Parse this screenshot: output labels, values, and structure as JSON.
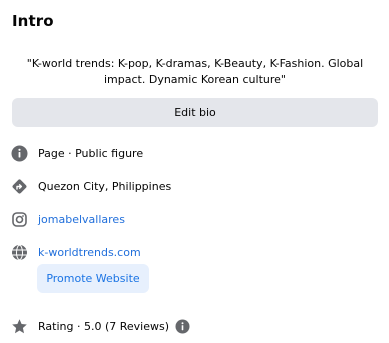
{
  "intro": {
    "title": "Intro",
    "bio": "\"K-world trends: K-pop, K-dramas, K-Beauty, K-Fashion. Global impact. Dynamic Korean culture\"",
    "edit_bio_label": "Edit bio"
  },
  "details": {
    "category": {
      "icon": "info-icon",
      "text": "Page · Public figure"
    },
    "location": {
      "icon": "directions-icon",
      "text": "Quezon City, Philippines"
    },
    "instagram": {
      "icon": "instagram-icon",
      "text": "jomabelvallares"
    },
    "website": {
      "icon": "globe-icon",
      "text": "k-worldtrends.com"
    },
    "promote_label": "Promote Website",
    "rating": {
      "icon": "star-icon",
      "text": "Rating · 5.0 (7 Reviews)"
    }
  },
  "colors": {
    "icon_gray": "#65676b",
    "link_blue": "#216fdb",
    "button_gray": "#e4e6eb",
    "promote_bg": "#e7f0fd"
  }
}
